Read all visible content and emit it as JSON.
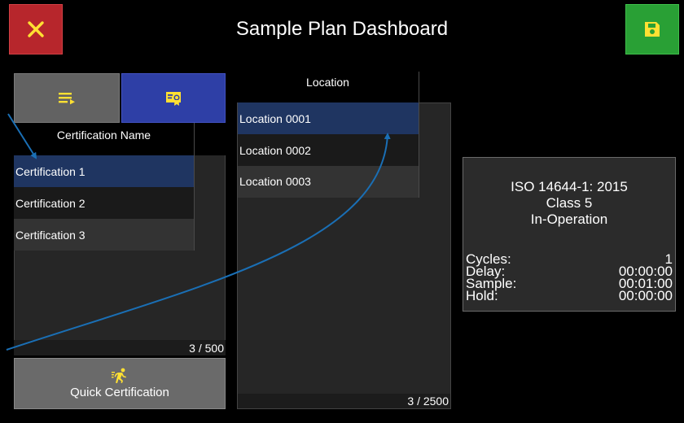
{
  "header": {
    "title": "Sample Plan Dashboard",
    "close_icon": "close-icon",
    "save_icon": "save-icon",
    "colors": {
      "close": "#b7262c",
      "save": "#29a035",
      "icon_yellow": "#ffe033"
    }
  },
  "toggles": {
    "list_icon": "list-icon",
    "cert_icon": "certificate-icon"
  },
  "certifications": {
    "column_header": "Certification Name",
    "items": [
      "Certification 1",
      "Certification 2",
      "Certification 3"
    ],
    "selected_index": 0,
    "count": "3 / 500"
  },
  "locations": {
    "column_header": "Location",
    "items": [
      "Location 0001",
      "Location 0002",
      "Location 0003"
    ],
    "selected_index": 0,
    "count": "3 / 2500"
  },
  "quick_button": {
    "label": "Quick Certification",
    "icon": "running-person-icon"
  },
  "info_panel": {
    "standard": "ISO 14644-1: 2015",
    "class": "Class 5",
    "state": "In-Operation",
    "fields": [
      {
        "label": "Cycles:",
        "value": "1"
      },
      {
        "label": "Delay:",
        "value": "00:00:00"
      },
      {
        "label": "Sample:",
        "value": "00:01:00"
      },
      {
        "label": "Hold:",
        "value": "00:00:00"
      }
    ]
  }
}
